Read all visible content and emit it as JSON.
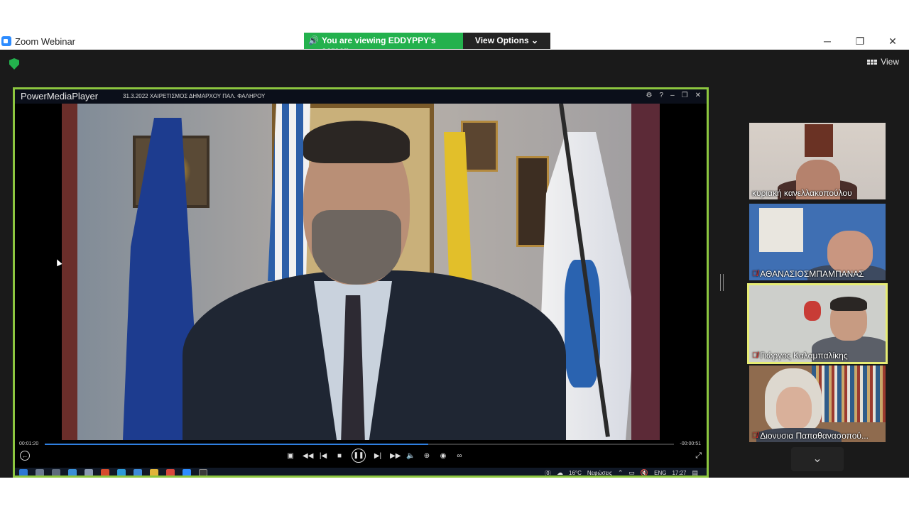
{
  "window": {
    "app_title": "Zoom Webinar",
    "minimize_glyph": "─",
    "restore_glyph": "❐",
    "close_glyph": "✕"
  },
  "share_banner": {
    "text": "You are viewing EDDYPPY's screen",
    "view_options_label": "View Options ⌄",
    "accent_color": "#23b14d"
  },
  "toolbar": {
    "view_label": "View"
  },
  "shared_screen": {
    "border_color": "#8cc63f",
    "player": {
      "name": "PowerMediaPlayer",
      "caption": "31.3.2022 ΧΑΙΡΕΤΙΣΜΟΣ ΔΗΜΑΡΧΟΥ ΠΑΛ. ΦΑΛΗΡΟΥ",
      "time_elapsed": "00:01:20",
      "time_remaining": "-00:00:51",
      "progress_fraction": 0.61
    },
    "taskbar": {
      "temperature": "16°C",
      "weather": "Νεφώσεις",
      "language": "ENG",
      "clock": "17:27"
    }
  },
  "participants": [
    {
      "name": "κυριακή κανελλακοπούλου",
      "muted": false,
      "active": false
    },
    {
      "name": "ΑΘΑΝΑΣΙΟΣΜΠΑΜΠΑΝΑΣ",
      "muted": true,
      "active": false
    },
    {
      "name": "Γιώργος Καλαμπαλίκης",
      "muted": true,
      "active": true
    },
    {
      "name": "Διονυσια Παπαθανασοπού...",
      "muted": true,
      "active": false
    }
  ],
  "active_speaker_color": "#e6ec74"
}
